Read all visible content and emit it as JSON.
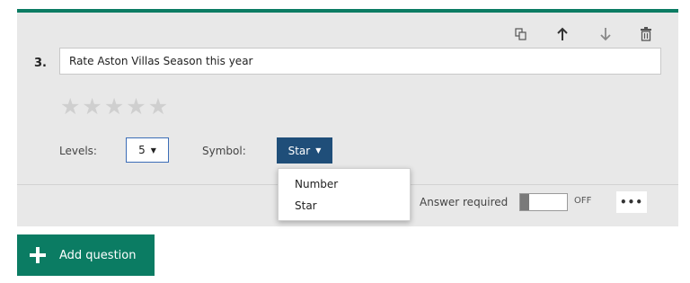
{
  "question": {
    "number": "3.",
    "title": "Rate Aston Villas Season this year",
    "rating": {
      "levels": 5,
      "symbol": "star"
    }
  },
  "toolbar": {
    "icons": [
      "copy-icon",
      "arrow-up-icon",
      "arrow-down-icon",
      "trash-icon"
    ]
  },
  "settings": {
    "levels_label": "Levels:",
    "levels_value": "5",
    "symbol_label": "Symbol:",
    "symbol_value": "Star"
  },
  "symbol_dropdown": {
    "options": [
      "Number",
      "Star"
    ]
  },
  "footer": {
    "answer_required_label": "Answer required",
    "toggle_state": "OFF",
    "more_label": "•••"
  },
  "add_question": {
    "label": "Add question"
  },
  "colors": {
    "accent_green": "#0b7c63",
    "symbol_button": "#1f4e79",
    "card_bg": "#e8e8e8"
  }
}
